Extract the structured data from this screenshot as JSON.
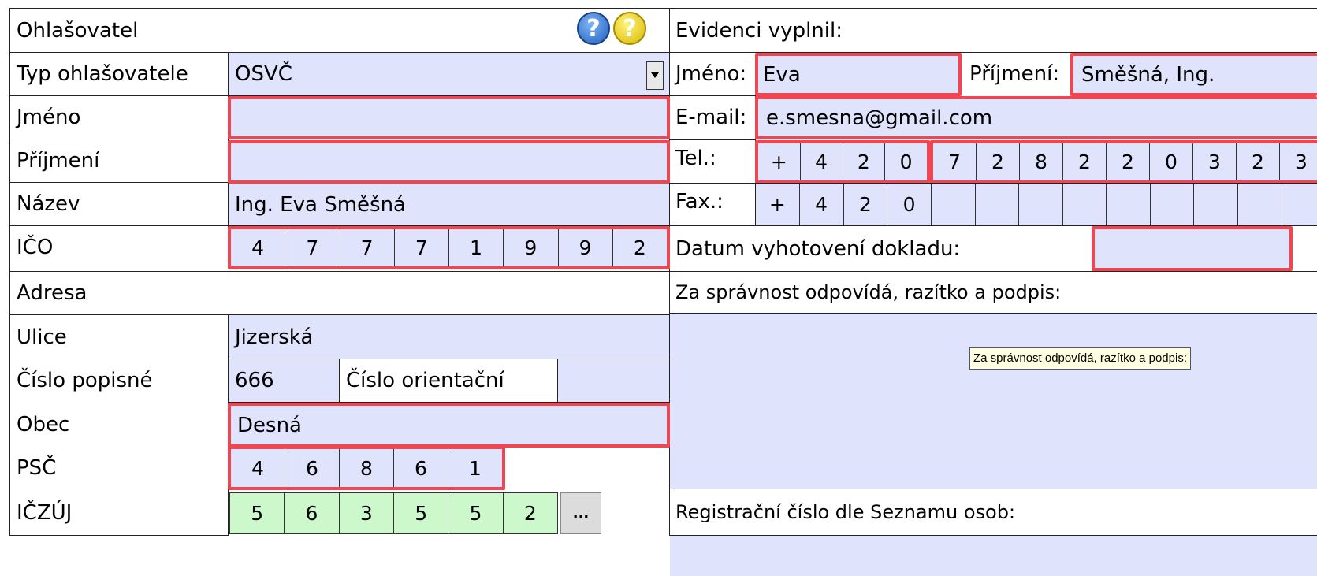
{
  "left": {
    "section_title": "Ohlašovatel",
    "rows": {
      "typ_label": "Typ ohlašovatele",
      "typ_value": "OSVČ",
      "jmeno_label": "Jméno",
      "jmeno_value": "",
      "prijmeni_label": "Příjmení",
      "prijmeni_value": "",
      "nazev_label": "Název",
      "nazev_value": "Ing. Eva Směšná",
      "ico_label": "IČO",
      "ico_digits": [
        "4",
        "7",
        "7",
        "7",
        "1",
        "9",
        "9",
        "2"
      ]
    },
    "address_title": "Adresa",
    "address": {
      "ulice_label": "Ulice",
      "ulice_value": "Jizerská",
      "cp_label": "Číslo popisné",
      "cp_value": "666",
      "co_label": "Číslo orientační",
      "co_value": "",
      "obec_label": "Obec",
      "obec_value": "Desná",
      "psc_label": "PSČ",
      "psc_digits": [
        "4",
        "6",
        "8",
        "6",
        "1"
      ],
      "iczuj_label": "IČZÚJ",
      "iczuj_digits": [
        "5",
        "6",
        "3",
        "5",
        "5",
        "2"
      ],
      "browse_label": "..."
    }
  },
  "right": {
    "section_title": "Evidenci vyplnil:",
    "jmeno_label": "Jméno:",
    "jmeno_value": "Eva",
    "prijmeni_label": "Příjmení:",
    "prijmeni_value": "Směšná, Ing.",
    "email_label": "E-mail:",
    "email_value": "e.smesna@gmail.com",
    "tel_label": "Tel.:",
    "tel_prefix": [
      "+",
      "4",
      "2",
      "0"
    ],
    "tel_digits": [
      "7",
      "2",
      "8",
      "2",
      "2",
      "0",
      "3",
      "2",
      "3"
    ],
    "fax_label": "Fax.:",
    "fax_prefix": [
      "+",
      "4",
      "2",
      "0"
    ],
    "fax_digits": [
      "",
      "",
      "",
      "",
      "",
      "",
      "",
      "",
      ""
    ],
    "datum_label": "Datum vyhotovení dokladu:",
    "datum_value": "",
    "signature_label": "Za správnost odpovídá, razítko a podpis:",
    "tooltip": "Za správnost odpovídá, razítko a podpis:",
    "reg_label": "Registrační číslo dle Seznamu osob:"
  },
  "icons": {
    "help_blue": "?",
    "help_yellow": "?"
  },
  "colors": {
    "field": "#dfe3fb",
    "highlight": "#ef4652",
    "green": "#ccf8cc"
  }
}
